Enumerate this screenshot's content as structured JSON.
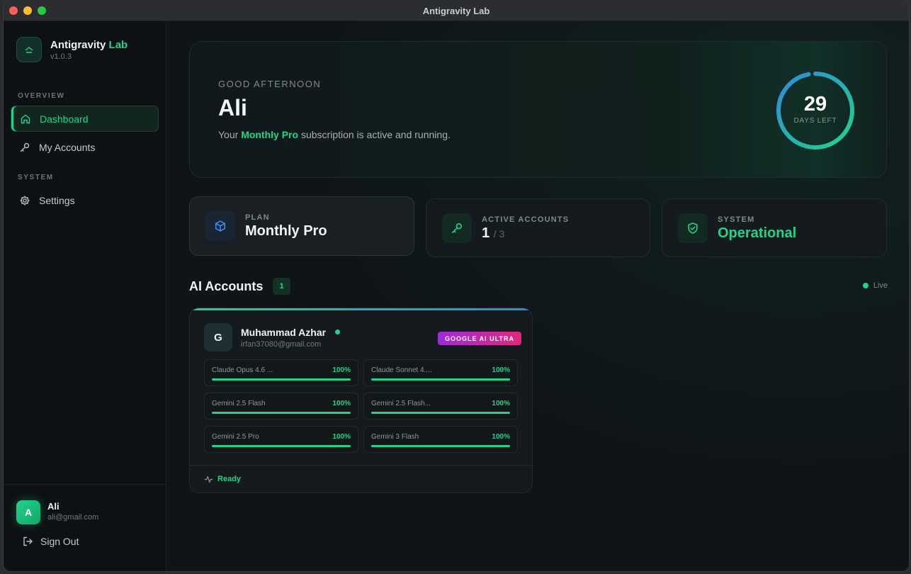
{
  "window": {
    "title": "Antigravity Lab"
  },
  "brand": {
    "name": "Antigravity",
    "name_accent": "Lab",
    "version": "v1.0.3"
  },
  "sidebar": {
    "section_overview": "OVERVIEW",
    "section_system": "SYSTEM",
    "items": [
      {
        "label": "Dashboard",
        "icon": "home-icon",
        "active": true
      },
      {
        "label": "My Accounts",
        "icon": "key-icon"
      },
      {
        "label": "Settings",
        "icon": "gear-icon"
      }
    ]
  },
  "user": {
    "initial": "A",
    "name": "Ali",
    "email": "ali@gmail.com",
    "signout_label": "Sign Out"
  },
  "hero": {
    "greeting": "GOOD AFTERNOON",
    "name": "Ali",
    "sub_prefix": "Your ",
    "plan": "Monthly Pro",
    "sub_suffix": " subscription is active and running.",
    "days_left": "29",
    "days_left_label": "DAYS LEFT",
    "days_progress": 0.97
  },
  "stats": {
    "plan_label": "PLAN",
    "plan_value": "Monthly Pro",
    "accounts_label": "ACTIVE ACCOUNTS",
    "accounts_active": "1",
    "accounts_total": "/ 3",
    "system_label": "SYSTEM",
    "system_value": "Operational"
  },
  "accounts_section": {
    "title": "AI Accounts",
    "count": "1",
    "live_label": "Live"
  },
  "account": {
    "initial": "G",
    "name": "Muhammad Azhar",
    "email": "irfan37080@gmail.com",
    "tier": "GOOGLE AI ULTRA",
    "status": "Ready",
    "quotas": [
      {
        "name": "Claude Opus 4.6 ...",
        "pct": "100%",
        "value": 1.0
      },
      {
        "name": "Claude Sonnet 4....",
        "pct": "100%",
        "value": 1.0
      },
      {
        "name": "Gemini 2.5 Flash",
        "pct": "100%",
        "value": 1.0
      },
      {
        "name": "Gemini 2.5 Flash...",
        "pct": "100%",
        "value": 1.0
      },
      {
        "name": "Gemini 2.5 Pro",
        "pct": "100%",
        "value": 1.0
      },
      {
        "name": "Gemini 3 Flash",
        "pct": "100%",
        "value": 1.0
      }
    ]
  },
  "colors": {
    "accent": "#22d38a",
    "accent_blue": "#2f8ad8",
    "background": "#0f1417"
  }
}
